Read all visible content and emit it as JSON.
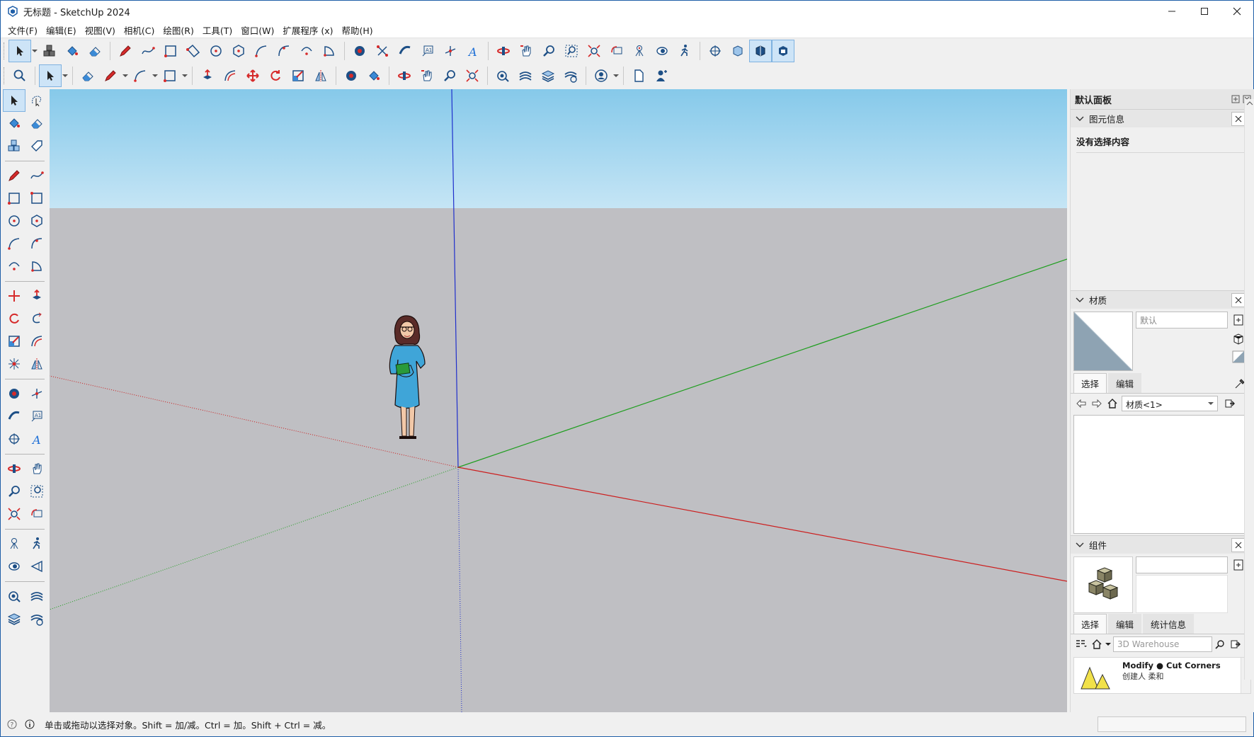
{
  "window": {
    "title": "无标题 - SketchUp 2024",
    "controls": [
      "minimize",
      "maximize",
      "close"
    ]
  },
  "menu": [
    "文件(F)",
    "编辑(E)",
    "视图(V)",
    "相机(C)",
    "绘图(R)",
    "工具(T)",
    "窗口(W)",
    "扩展程序 (x)",
    "帮助(H)"
  ],
  "toolbar_icons": {
    "row1": [
      "select-icon",
      "component-icon",
      "paint-bucket-icon",
      "eraser-icon",
      "pencil-icon",
      "freehand-icon",
      "rectangle-icon",
      "rotated-rectangle-icon",
      "circle-icon",
      "polygon-icon",
      "arc-icon",
      "2point-arc-icon",
      "3point-arc-icon",
      "pie-icon",
      "push-pull-icon",
      "move-icon",
      "follow-me-icon",
      "dimension-icon",
      "axes-icon",
      "3d-text-icon",
      "orbit-icon",
      "pan-icon",
      "zoom-icon",
      "zoom-window-icon",
      "zoom-extents-icon",
      "previous-view-icon",
      "position-camera-icon",
      "look-around-icon",
      "walk-icon",
      "section-plane-icon",
      "display-section-icon",
      "section-cuts-icon",
      "section-fill-icon"
    ],
    "row2": [
      "search-icon",
      "select-icon",
      "eraser-icon",
      "pencil-icon",
      "arc-icon",
      "rectangle-icon",
      "push-pull-icon",
      "offset-icon",
      "move-icon",
      "rotate-icon",
      "scale-icon",
      "flip-icon",
      "tape-icon",
      "paint-bucket-icon",
      "orbit-icon",
      "pan-icon",
      "zoom-icon",
      "zoom-extents-icon",
      "add-location-icon",
      "show-terrain-icon",
      "sandbox-icon",
      "warehouse-icon",
      "account-icon",
      "new-file-icon",
      "user-icon"
    ]
  },
  "statusbar": {
    "hint": "单击或拖动以选择对象。Shift = 加/减。Ctrl = 加。Shift + Ctrl = 减。"
  },
  "tray": {
    "title": "默认面板",
    "entity_info": {
      "title": "图元信息",
      "no_selection": "没有选择内容"
    },
    "materials": {
      "title": "材质",
      "name_placeholder": "默认",
      "tab_select": "选择",
      "tab_edit": "编辑",
      "collection": "材质<1>"
    },
    "components": {
      "title": "组件",
      "tab_select": "选择",
      "tab_edit": "编辑",
      "tab_stats": "统计信息",
      "search_placeholder": "3D Warehouse",
      "result_title": "Modify ● Cut Corners",
      "result_by": "创建人 柔和"
    }
  },
  "colors": {
    "sky_top": "#86c9ea",
    "sky_bottom": "#c5e5f5",
    "ground": "#bfbfc3",
    "axis_red": "#cc1f1f",
    "axis_green": "#1f9e1f",
    "axis_blue": "#1f2fcc",
    "active_tool": "#cde4f7"
  }
}
